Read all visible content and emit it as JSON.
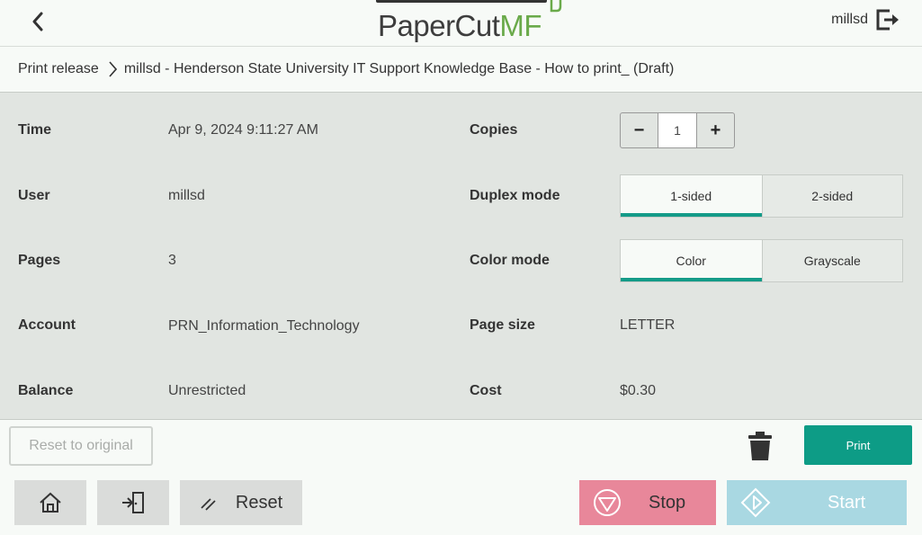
{
  "header": {
    "logo_main": "PaperCut",
    "logo_suffix": "MF",
    "username": "millsd"
  },
  "breadcrumb": {
    "root": "Print release",
    "current": "millsd - Henderson State University IT Support Knowledge Base - How to print_ (Draft)"
  },
  "details": {
    "time_label": "Time",
    "time_value": "Apr 9, 2024 9:11:27 AM",
    "user_label": "User",
    "user_value": "millsd",
    "pages_label": "Pages",
    "pages_value": "3",
    "account_label": "Account",
    "account_value": "PRN_Information_Technology",
    "balance_label": "Balance",
    "balance_value": "Unrestricted",
    "copies_label": "Copies",
    "copies_value": "1",
    "copies_minus": "−",
    "copies_plus": "+",
    "duplex_label": "Duplex mode",
    "duplex_options": [
      "1-sided",
      "2-sided"
    ],
    "duplex_selected": "1-sided",
    "color_label": "Color mode",
    "color_options": [
      "Color",
      "Grayscale"
    ],
    "color_selected": "Color",
    "pagesize_label": "Page size",
    "pagesize_value": "LETTER",
    "cost_label": "Cost",
    "cost_value": "$0.30"
  },
  "actions": {
    "reset_original": "Reset to original",
    "print": "Print"
  },
  "device_bar": {
    "reset": "Reset",
    "stop": "Stop",
    "start": "Start"
  },
  "colors": {
    "accent": "#149b88",
    "print_button": "#0d9c86",
    "stop_button": "#e8879a",
    "start_button": "#a9d8e2",
    "logo_green": "#6aaa4a"
  },
  "icons": [
    "back-arrow-icon",
    "logout-icon",
    "chevron-right-icon",
    "trash-icon",
    "home-icon",
    "exit-door-icon",
    "reset-slash-icon",
    "stop-icon",
    "start-icon"
  ]
}
